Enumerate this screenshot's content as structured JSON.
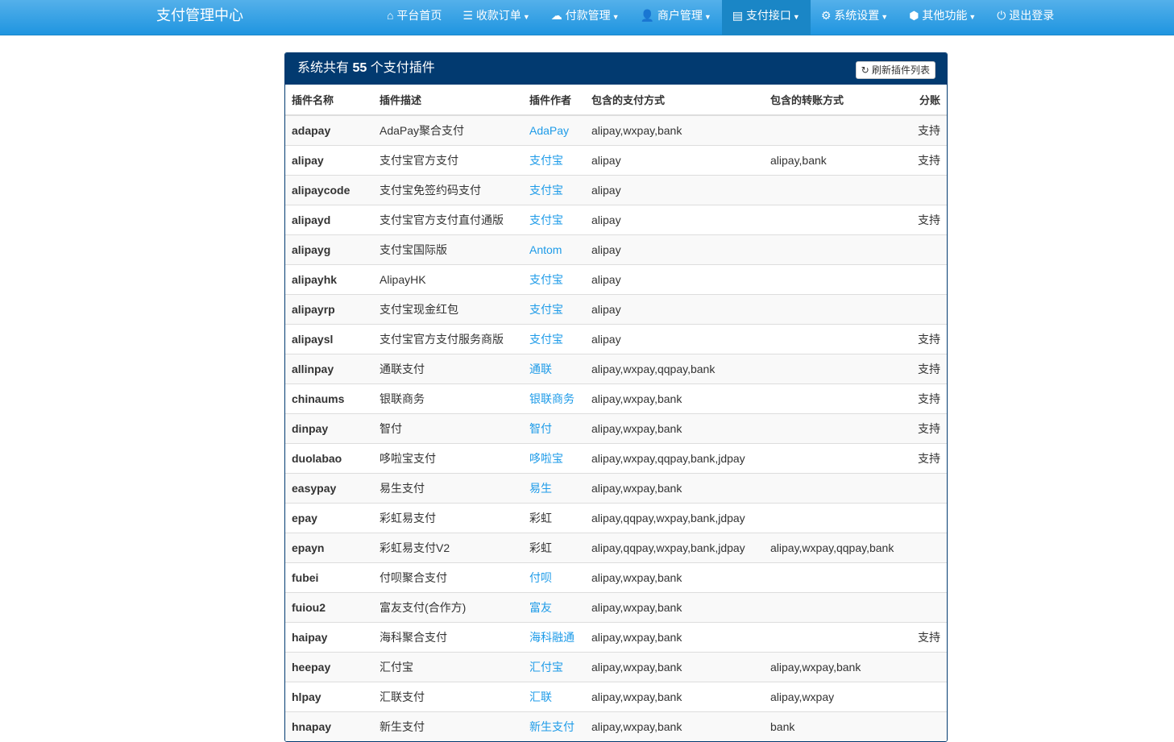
{
  "nav": {
    "brand": "支付管理中心",
    "items": [
      {
        "icon": "home-icon",
        "glyph": "⌂",
        "label": "平台首页",
        "caret": false
      },
      {
        "icon": "list-icon",
        "glyph": "☰",
        "label": "收款订单",
        "caret": true
      },
      {
        "icon": "cloud-icon",
        "glyph": "☁",
        "label": "付款管理",
        "caret": true
      },
      {
        "icon": "user-icon",
        "glyph": "👤",
        "label": "商户管理",
        "caret": true
      },
      {
        "icon": "credit-card-icon",
        "glyph": "▤",
        "label": "支付接口",
        "caret": true,
        "active": true
      },
      {
        "icon": "gear-icon",
        "glyph": "⚙",
        "label": "系统设置",
        "caret": true
      },
      {
        "icon": "cube-icon",
        "glyph": "⬢",
        "label": "其他功能",
        "caret": true
      },
      {
        "icon": "power-icon",
        "glyph": "⏻",
        "label": "退出登录",
        "caret": false
      }
    ]
  },
  "panel": {
    "title_prefix": "系统共有",
    "count": "55",
    "title_suffix": "个支付插件",
    "refresh_label": "刷新插件列表",
    "refresh_glyph": "↻"
  },
  "table": {
    "headers": [
      "插件名称",
      "插件描述",
      "插件作者",
      "包含的支付方式",
      "包含的转账方式",
      "分账"
    ],
    "rows": [
      [
        "adapay",
        "AdaPay聚合支付",
        "AdaPay",
        "alipay,wxpay,bank",
        "",
        "支持",
        true
      ],
      [
        "alipay",
        "支付宝官方支付",
        "支付宝",
        "alipay",
        "alipay,bank",
        "支持",
        true
      ],
      [
        "alipaycode",
        "支付宝免签约码支付",
        "支付宝",
        "alipay",
        "",
        "",
        true
      ],
      [
        "alipayd",
        "支付宝官方支付直付通版",
        "支付宝",
        "alipay",
        "",
        "支持",
        true
      ],
      [
        "alipayg",
        "支付宝国际版",
        "Antom",
        "alipay",
        "",
        "",
        true
      ],
      [
        "alipayhk",
        "AlipayHK",
        "支付宝",
        "alipay",
        "",
        "",
        true
      ],
      [
        "alipayrp",
        "支付宝现金红包",
        "支付宝",
        "alipay",
        "",
        "",
        true
      ],
      [
        "alipaysl",
        "支付宝官方支付服务商版",
        "支付宝",
        "alipay",
        "",
        "支持",
        true
      ],
      [
        "allinpay",
        "通联支付",
        "通联",
        "alipay,wxpay,qqpay,bank",
        "",
        "支持",
        true
      ],
      [
        "chinaums",
        "银联商务",
        "银联商务",
        "alipay,wxpay,bank",
        "",
        "支持",
        true
      ],
      [
        "dinpay",
        "智付",
        "智付",
        "alipay,wxpay,bank",
        "",
        "支持",
        true
      ],
      [
        "duolabao",
        "哆啦宝支付",
        "哆啦宝",
        "alipay,wxpay,qqpay,bank,jdpay",
        "",
        "支持",
        true
      ],
      [
        "easypay",
        "易生支付",
        "易生",
        "alipay,wxpay,bank",
        "",
        "",
        true
      ],
      [
        "epay",
        "彩虹易支付",
        "彩虹",
        "alipay,qqpay,wxpay,bank,jdpay",
        "",
        "",
        false
      ],
      [
        "epayn",
        "彩虹易支付V2",
        "彩虹",
        "alipay,qqpay,wxpay,bank,jdpay",
        "alipay,wxpay,qqpay,bank",
        "",
        false
      ],
      [
        "fubei",
        "付呗聚合支付",
        "付呗",
        "alipay,wxpay,bank",
        "",
        "",
        true
      ],
      [
        "fuiou2",
        "富友支付(合作方)",
        "富友",
        "alipay,wxpay,bank",
        "",
        "",
        true
      ],
      [
        "haipay",
        "海科聚合支付",
        "海科融通",
        "alipay,wxpay,bank",
        "",
        "支持",
        true
      ],
      [
        "heepay",
        "汇付宝",
        "汇付宝",
        "alipay,wxpay,bank",
        "alipay,wxpay,bank",
        "",
        true
      ],
      [
        "hlpay",
        "汇联支付",
        "汇联",
        "alipay,wxpay,bank",
        "alipay,wxpay",
        "",
        true
      ],
      [
        "hnapay",
        "新生支付",
        "新生支付",
        "alipay,wxpay,bank",
        "bank",
        "",
        true
      ]
    ]
  }
}
